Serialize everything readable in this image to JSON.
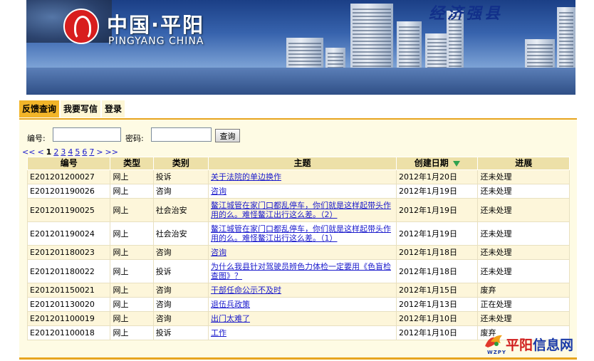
{
  "header": {
    "site_title": "中国·平阳",
    "site_subtitle": "PINGYANG CHINA",
    "slogan": "经济强县"
  },
  "tabs": [
    {
      "label": "反馈查询",
      "active": true
    },
    {
      "label": "我要写信",
      "active": false
    },
    {
      "label": "登录",
      "active": false
    }
  ],
  "search": {
    "id_label": "编号:",
    "id_value": "",
    "password_label": "密码:",
    "password_value": "",
    "query_button": "查询"
  },
  "pager": {
    "first": "<<",
    "prev": "<",
    "pages": [
      "1",
      "2",
      "3",
      "4",
      "5",
      "6",
      "7"
    ],
    "current": "1",
    "next": ">",
    "last": ">>"
  },
  "table": {
    "columns": [
      "编号",
      "类型",
      "类别",
      "主题",
      "创建日期",
      "进展"
    ],
    "rows": [
      {
        "id": "E201201200027",
        "type": "网上",
        "category": "投诉",
        "topic": "关于法院的单边换作",
        "date": "2012年1月20日",
        "status": "还未处理",
        "tall": false
      },
      {
        "id": "E201201190026",
        "type": "网上",
        "category": "咨询",
        "topic": "咨询",
        "date": "2012年1月19日",
        "status": "还未处理",
        "tall": false
      },
      {
        "id": "E201201190025",
        "type": "网上",
        "category": "社会治安",
        "topic": "鳌江城管在家门口都乱停车，你们就是这样起带头作用的么。难怪鳌江出行这么差。（2）",
        "date": "2012年1月19日",
        "status": "还未处理",
        "tall": true
      },
      {
        "id": "E201201190024",
        "type": "网上",
        "category": "社会治安",
        "topic": "鳌江城管在家门口都乱停车，你们就是这样起带头作用的么。难怪鳌江出行这么差。（1）",
        "date": "2012年1月19日",
        "status": "还未处理",
        "tall": true
      },
      {
        "id": "E201201180023",
        "type": "网上",
        "category": "咨询",
        "topic": "咨询",
        "date": "2012年1月18日",
        "status": "还未处理",
        "tall": false
      },
      {
        "id": "E201201180022",
        "type": "网上",
        "category": "投诉",
        "topic": "为什么我县针对驾驶员辨色力体检一定要用《色盲检查图》？",
        "date": "2012年1月18日",
        "status": "还未处理",
        "tall": true
      },
      {
        "id": "E201201150021",
        "type": "网上",
        "category": "咨询",
        "topic": "干部任命公示不及时",
        "date": "2012年1月15日",
        "status": "废弃",
        "tall": false
      },
      {
        "id": "E201201130020",
        "type": "网上",
        "category": "咨询",
        "topic": "退伍兵政策",
        "date": "2012年1月13日",
        "status": "正在处理",
        "tall": false
      },
      {
        "id": "E201201100019",
        "type": "网上",
        "category": "咨询",
        "topic": "出门太难了",
        "date": "2012年1月10日",
        "status": "还未处理",
        "tall": false
      },
      {
        "id": "E201201100018",
        "type": "网上",
        "category": "投诉",
        "topic": "工作",
        "date": "2012年1月10日",
        "status": "废弃",
        "tall": false
      }
    ]
  },
  "watermark": {
    "text_red": "平阳",
    "text_blue": "信息网",
    "sub": "WZPY"
  },
  "colors": {
    "tab_active": "#f2b529",
    "panel_bg": "#fefbe4",
    "header_row": "#ede0a8",
    "link": "#1a1acc",
    "sort_icon": "#2fa24f"
  }
}
